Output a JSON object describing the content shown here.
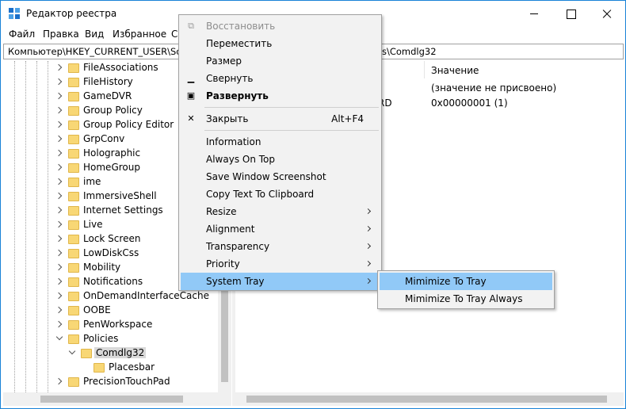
{
  "window": {
    "title": "Редактор реестра"
  },
  "menubar": {
    "items": [
      "Файл",
      "Правка",
      "Вид",
      "Избранное",
      "С"
    ]
  },
  "address": {
    "left": "Компьютер\\HKEY_CURRENT_USER\\Softw",
    "right": "s\\Comdlg32"
  },
  "tree": {
    "items": [
      "FileAssociations",
      "FileHistory",
      "GameDVR",
      "Group Policy",
      "Group Policy Editor",
      "GrpConv",
      "Holographic",
      "HomeGroup",
      "ime",
      "ImmersiveShell",
      "Internet Settings",
      "Live",
      "Lock Screen",
      "LowDiskCss",
      "Mobility",
      "Notifications",
      "OnDemandInterfaceCache",
      "OOBE",
      "PenWorkspace",
      "Policies",
      "Comdlg32",
      "Placesbar",
      "PrecisionTouchPad"
    ]
  },
  "values_pane": {
    "column_value": "Значение",
    "rows": [
      {
        "type_fragment": "",
        "value": "(значение не присвоено)"
      },
      {
        "type_fragment": "RD",
        "value": "0x00000001 (1)"
      }
    ]
  },
  "context_menu": {
    "restore": "Восстановить",
    "move": "Переместить",
    "size": "Размер",
    "minimize": "Свернуть",
    "maximize": "Развернуть",
    "close": "Закрыть",
    "close_shortcut": "Alt+F4",
    "information": "Information",
    "always_on_top": "Always On Top",
    "save_screenshot": "Save Window Screenshot",
    "copy_text": "Copy Text To Clipboard",
    "resize": "Resize",
    "alignment": "Alignment",
    "transparency": "Transparency",
    "priority": "Priority",
    "system_tray": "System Tray"
  },
  "submenu": {
    "minimize_to_tray": "Mimimize To Tray",
    "minimize_to_tray_always": "Mimimize To Tray Always"
  },
  "colors": {
    "highlight": "#91c9f7",
    "window_border": "#1883d7",
    "folder": "#f8d775"
  }
}
